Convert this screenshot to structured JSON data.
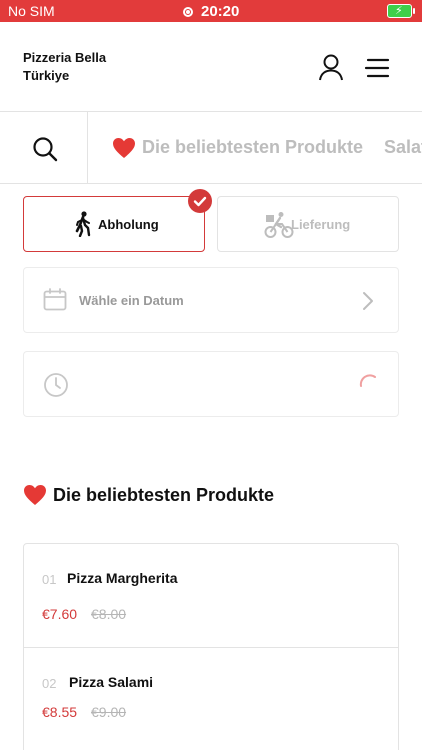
{
  "status_bar": {
    "carrier": "No SIM",
    "time": "20:20"
  },
  "header": {
    "restaurant_name": "Pizzeria Bella Türkiye"
  },
  "categories": [
    {
      "label": "Die beliebtesten Produkte"
    },
    {
      "label": "Salat"
    }
  ],
  "delivery_mode": {
    "pickup_label": "Abholung",
    "delivery_label": "Lieferung",
    "selected": "pickup"
  },
  "date_picker": {
    "placeholder": "Wähle ein Datum"
  },
  "section": {
    "title": "Die beliebtesten Produkte"
  },
  "products": [
    {
      "index": "01",
      "name": "Pizza Margherita",
      "price": "€7.60",
      "old_price": "€8.00"
    },
    {
      "index": "02",
      "name": "Pizza Salami",
      "price": "€8.55",
      "old_price": "€9.00"
    }
  ],
  "colors": {
    "accent": "#d33a3a",
    "statusbar": "#e23b3b",
    "heart": "#e53935"
  }
}
